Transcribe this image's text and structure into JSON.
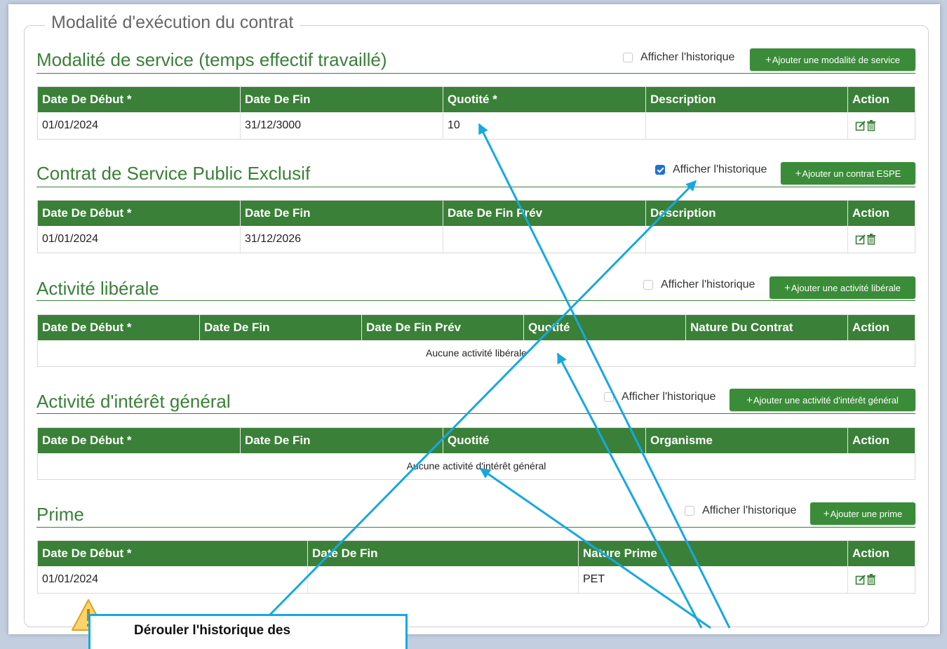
{
  "fieldset": {
    "legend": "Modalité d'exécution du contrat"
  },
  "sections": {
    "service": {
      "title": "Modalité de service (temps effectif travaillé)",
      "history_label": "Afficher l'historique",
      "history_checked": false,
      "add_button": "Ajouter une modalité de service",
      "columns": [
        "Date De Début *",
        "Date De Fin",
        "Quotité *",
        "Description",
        "Action"
      ],
      "rows": [
        [
          "01/01/2024",
          "31/12/3000",
          "10",
          ""
        ]
      ]
    },
    "espe": {
      "title": "Contrat de Service Public Exclusif",
      "history_label": "Afficher l'historique",
      "history_checked": true,
      "add_button": "Ajouter un contrat ESPE",
      "columns": [
        "Date De Début *",
        "Date De Fin",
        "Date De Fin Prév",
        "Description",
        "Action"
      ],
      "rows": [
        [
          "01/01/2024",
          "31/12/2026",
          "",
          ""
        ]
      ]
    },
    "liberale": {
      "title": "Activité libérale",
      "history_label": "Afficher l'historique",
      "history_checked": false,
      "add_button": "Ajouter une activité libérale",
      "columns": [
        "Date De Début *",
        "Date De Fin",
        "Date De Fin Prév",
        "Quotité",
        "Nature Du Contrat",
        "Action"
      ],
      "empty": "Aucune activité libérale"
    },
    "interet": {
      "title": "Activité d'intérêt général",
      "history_label": "Afficher l'historique",
      "history_checked": false,
      "add_button": "Ajouter une activité d'intérêt général",
      "columns": [
        "Date De Début *",
        "Date De Fin",
        "Quotité",
        "Organisme",
        "Action"
      ],
      "empty": "Aucune activité d'intérêt général"
    },
    "prime": {
      "title": "Prime",
      "history_label": "Afficher l'historique",
      "history_checked": false,
      "add_button": "Ajouter une prime",
      "columns": [
        "Date De Début *",
        "Date De Fin",
        "Nature Prime",
        "Action"
      ],
      "rows": [
        [
          "01/01/2024",
          "",
          "PET"
        ]
      ]
    }
  },
  "callout": {
    "text": "Dérouler l'historique des"
  },
  "icons": {
    "edit": "edit-icon",
    "delete": "trash-icon",
    "warning": "warning-icon",
    "add": "plus-icon"
  },
  "colors": {
    "brand_green": "#3a8038",
    "button_green": "#3a8c38",
    "arrow": "#16a8e0",
    "checkbox_checked": "#1f6fd6"
  }
}
